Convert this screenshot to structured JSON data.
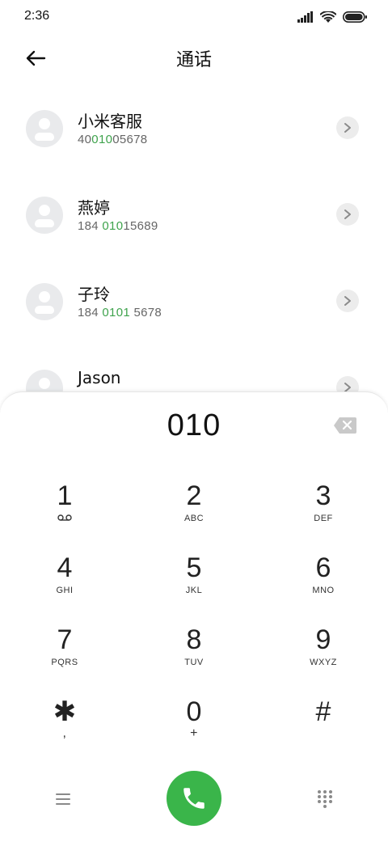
{
  "status_bar": {
    "time": "2:36",
    "icons": [
      "signal-icon",
      "wifi-icon",
      "battery-icon"
    ]
  },
  "header": {
    "title": "通话",
    "back_icon": "back-arrow-icon"
  },
  "contacts": [
    {
      "name": "小米客服",
      "number_parts": [
        {
          "text": "40",
          "hl": false
        },
        {
          "text": "010",
          "hl": true
        },
        {
          "text": "05678",
          "hl": false
        }
      ]
    },
    {
      "name": "燕婷",
      "number_parts": [
        {
          "text": "184 ",
          "hl": false
        },
        {
          "text": "010",
          "hl": true
        },
        {
          "text": "15689",
          "hl": false
        }
      ]
    },
    {
      "name": "子玲",
      "number_parts": [
        {
          "text": "184 ",
          "hl": false
        },
        {
          "text": "0101",
          "hl": true
        },
        {
          "text": " 5678",
          "hl": false
        }
      ]
    },
    {
      "name": "Jason",
      "number_parts": []
    }
  ],
  "dialer": {
    "display": "010",
    "keys": [
      {
        "digit": "1",
        "letters": "",
        "sub_icon": "voicemail-icon"
      },
      {
        "digit": "2",
        "letters": "ABC"
      },
      {
        "digit": "3",
        "letters": "DEF"
      },
      {
        "digit": "4",
        "letters": "GHI"
      },
      {
        "digit": "5",
        "letters": "JKL"
      },
      {
        "digit": "6",
        "letters": "MNO"
      },
      {
        "digit": "7",
        "letters": "PQRS"
      },
      {
        "digit": "8",
        "letters": "TUV"
      },
      {
        "digit": "9",
        "letters": "WXYZ"
      },
      {
        "digit": "✱",
        "letters": ","
      },
      {
        "digit": "0",
        "letters": "+"
      },
      {
        "digit": "#",
        "letters": ""
      }
    ]
  },
  "colors": {
    "accent_green": "#3ab54a",
    "match_green": "#3fa34d",
    "avatar_bg": "#e9eaec"
  }
}
